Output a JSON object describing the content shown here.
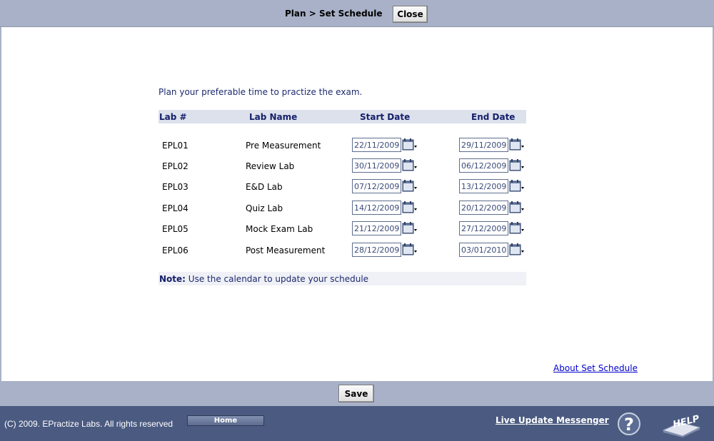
{
  "header": {
    "title": "Plan > Set Schedule",
    "close_label": "Close"
  },
  "intro": "Plan your preferable time to practize the exam.",
  "table": {
    "headers": {
      "lab": "Lab #",
      "name": "Lab Name",
      "start": "Start Date",
      "end": "End Date"
    },
    "rows": [
      {
        "code": "EPL01",
        "name": "Pre Measurement",
        "start": "22/11/2009",
        "end": "29/11/2009"
      },
      {
        "code": "EPL02",
        "name": "Review Lab",
        "start": "30/11/2009",
        "end": "06/12/2009"
      },
      {
        "code": "EPL03",
        "name": "E&D Lab",
        "start": "07/12/2009",
        "end": "13/12/2009"
      },
      {
        "code": "EPL04",
        "name": "Quiz Lab",
        "start": "14/12/2009",
        "end": "20/12/2009"
      },
      {
        "code": "EPL05",
        "name": "Mock Exam Lab",
        "start": "21/12/2009",
        "end": "27/12/2009"
      },
      {
        "code": "EPL06",
        "name": "Post Measurement",
        "start": "28/12/2009",
        "end": "03/01/2010"
      }
    ]
  },
  "note": {
    "label": "Note:",
    "text": " Use the calendar to update your schedule"
  },
  "about_link": "About Set Schedule",
  "save_label": "Save",
  "footer": {
    "copyright": "(C) 2009. EPractize Labs. All rights reserved",
    "home_label": "Home",
    "live_update": "Live Update Messenger",
    "help_text": "HELP",
    "question_mark": "?"
  },
  "icons": {
    "calendar": "calendar-icon",
    "help_question": "question-mark-icon",
    "help_book": "help-book-icon"
  },
  "colors": {
    "header_bar": "#a8b1c7",
    "footer_bar": "#4a5a80",
    "header_text": "#15206a",
    "link": "#0000cc"
  }
}
